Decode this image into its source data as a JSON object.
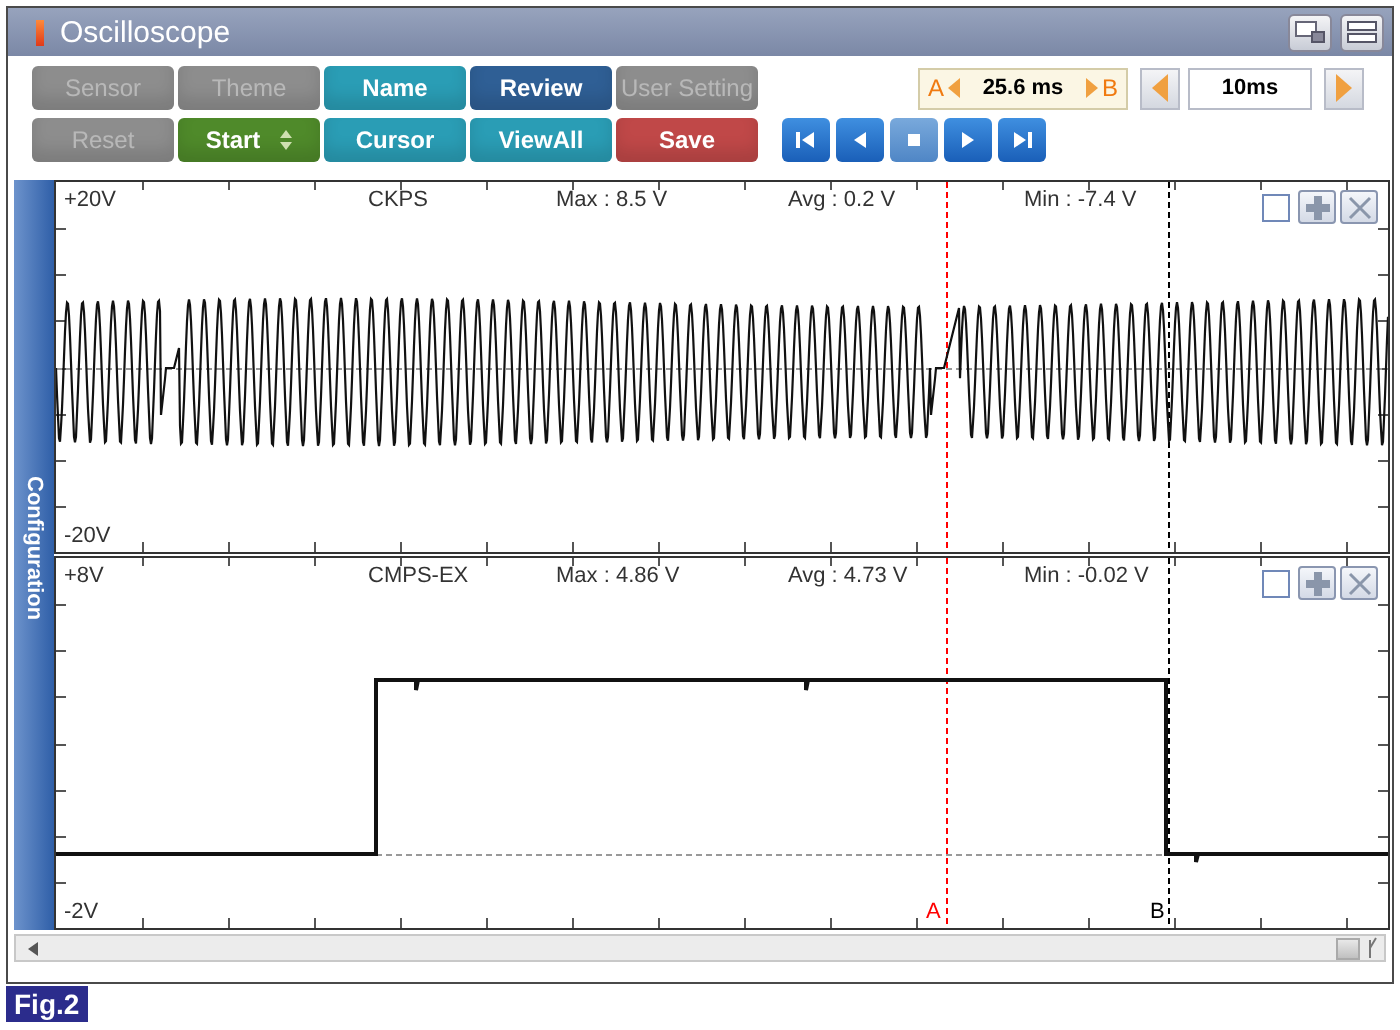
{
  "window": {
    "title": "Oscilloscope"
  },
  "buttons": [
    {
      "label": "Sensor",
      "kind": "plain",
      "color": "#c4c4c4",
      "disabled": true
    },
    {
      "label": "Theme",
      "kind": "plain",
      "color": "#c4c4c4",
      "disabled": true
    },
    {
      "label": "Name",
      "kind": "plain",
      "color": "#2a9db5",
      "disabled": false
    },
    {
      "label": "Review",
      "kind": "plain",
      "color": "#2f5f95",
      "disabled": false
    },
    {
      "label": "User Setting",
      "kind": "plain",
      "color": "#c4c4c4",
      "disabled": true
    },
    {
      "label": "Reset",
      "kind": "plain",
      "color": "#c4c4c4",
      "disabled": true
    },
    {
      "label": "Start",
      "kind": "spinner",
      "color": "#4f8a2a",
      "disabled": false
    },
    {
      "label": "Cursor",
      "kind": "plain",
      "color": "#2a9db5",
      "disabled": false
    },
    {
      "label": "ViewAll",
      "kind": "plain",
      "color": "#2a9db5",
      "disabled": false
    },
    {
      "label": "Save",
      "kind": "plain",
      "color": "#c04848",
      "disabled": false
    }
  ],
  "cursor_readout": {
    "a_label": "A",
    "value": "25.6 ms",
    "b_label": "B"
  },
  "time_div": {
    "value": "10ms"
  },
  "sidebar": {
    "label": "Configuration"
  },
  "channels": [
    {
      "name": "CKPS",
      "max": "Max : 8.5 V",
      "avg": "Avg : 0.2 V",
      "min": "Min : -7.4 V",
      "top": "+20V",
      "bottom": "-20V",
      "kind": "sine",
      "checked": false
    },
    {
      "name": "CMPS-EX",
      "max": "Max : 4.86 V",
      "avg": "Avg : 4.73 V",
      "min": "Min : -0.02 V",
      "top": "+8V",
      "bottom": "-2V",
      "kind": "square",
      "checked": false
    }
  ],
  "cursors": [
    {
      "label": "A",
      "color": "#ff0000"
    },
    {
      "label": "B",
      "color": "#000000"
    }
  ],
  "figure_label": "Fig.2"
}
